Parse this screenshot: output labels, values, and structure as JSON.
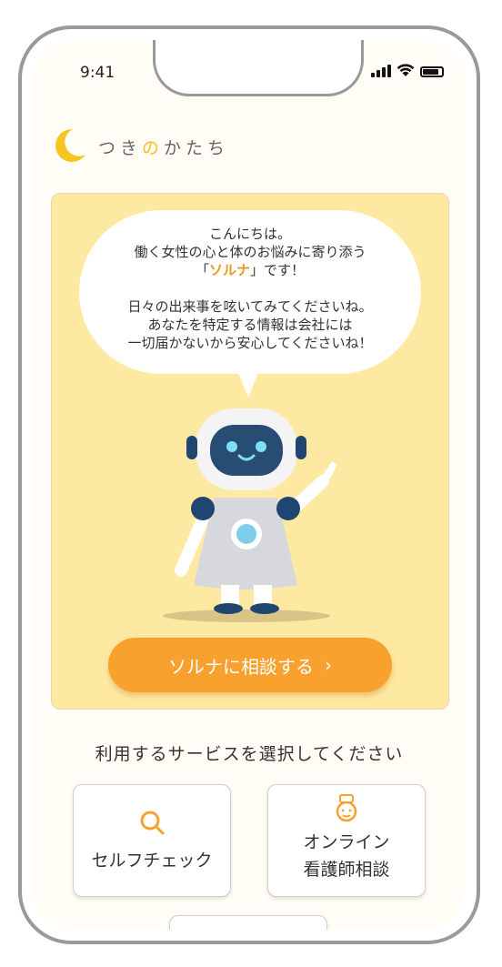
{
  "status_bar": {
    "time": "9:41"
  },
  "brand": {
    "name_before": "つき",
    "name_accent": "の",
    "name_after": "かたち",
    "accent_color": "#f5c020"
  },
  "hero": {
    "greeting_line1": "こんにちは。",
    "greeting_line2": "働く女性の心と体のお悩みに寄り添う",
    "name_open": "「",
    "name": "ソルナ",
    "name_close": "」です！",
    "body_line1": "日々の出来事を呟いてみてくださいね。",
    "body_line2": "あなたを特定する情報は会社には",
    "body_line3": "一切届かないから安心してくださいね！",
    "cta_label": "ソルナに相談する",
    "cta_icon": "chevron-right-icon",
    "cta_color": "#f8a12f",
    "background_color": "#fee9a2"
  },
  "services": {
    "title": "利用するサービスを選択してください",
    "items": [
      {
        "label": "セルフチェック",
        "icon": "search-icon"
      },
      {
        "label_line1": "オンライン",
        "label_line2": "看護師相談",
        "icon": "nurse-icon"
      }
    ]
  }
}
